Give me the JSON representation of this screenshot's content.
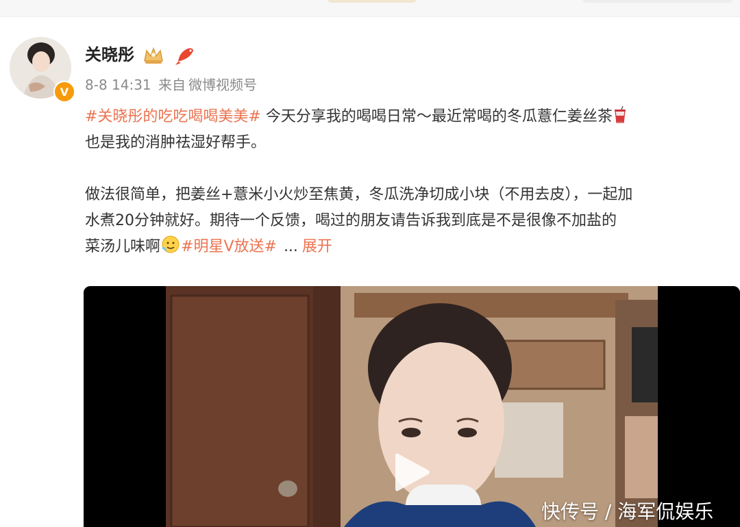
{
  "post": {
    "username": "关晓彤",
    "date": "8-8 14:31",
    "source_prefix": "来自",
    "source": "微博视频号",
    "topic1": "#关晓彤的吃吃喝喝美美#",
    "line1": " 今天分享我的喝喝日常～最近常喝的冬瓜薏仁姜丝茶",
    "line2": "也是我的消肿祛湿好帮手。",
    "para2_line1": "做法很简单，把姜丝+薏米小火炒至焦黄，冬瓜洗净切成小块（不用去皮），一起加",
    "para2_line2": "水煮20分钟就好。期待一个反馈，喝过的朋友请告诉我到底是不是很像不加盐的",
    "para2_line3": "菜汤儿味啊",
    "topic2": "#明星V放送#",
    "ellipsis": "...",
    "expand_label": "展开"
  },
  "icons": {
    "verified": "verified-v-icon",
    "crown": "crown-badge-icon",
    "koi": "koi-fish-icon",
    "cup": "drink-cup-icon",
    "emoji": "smile-emoji-icon",
    "play": "play-icon"
  },
  "badge": {
    "letter": "V"
  },
  "colors": {
    "topic": "#eb7350",
    "meta": "#8a8a8a",
    "verified": "#f79b0b"
  },
  "watermark": "快传号 / 海军侃娱乐"
}
